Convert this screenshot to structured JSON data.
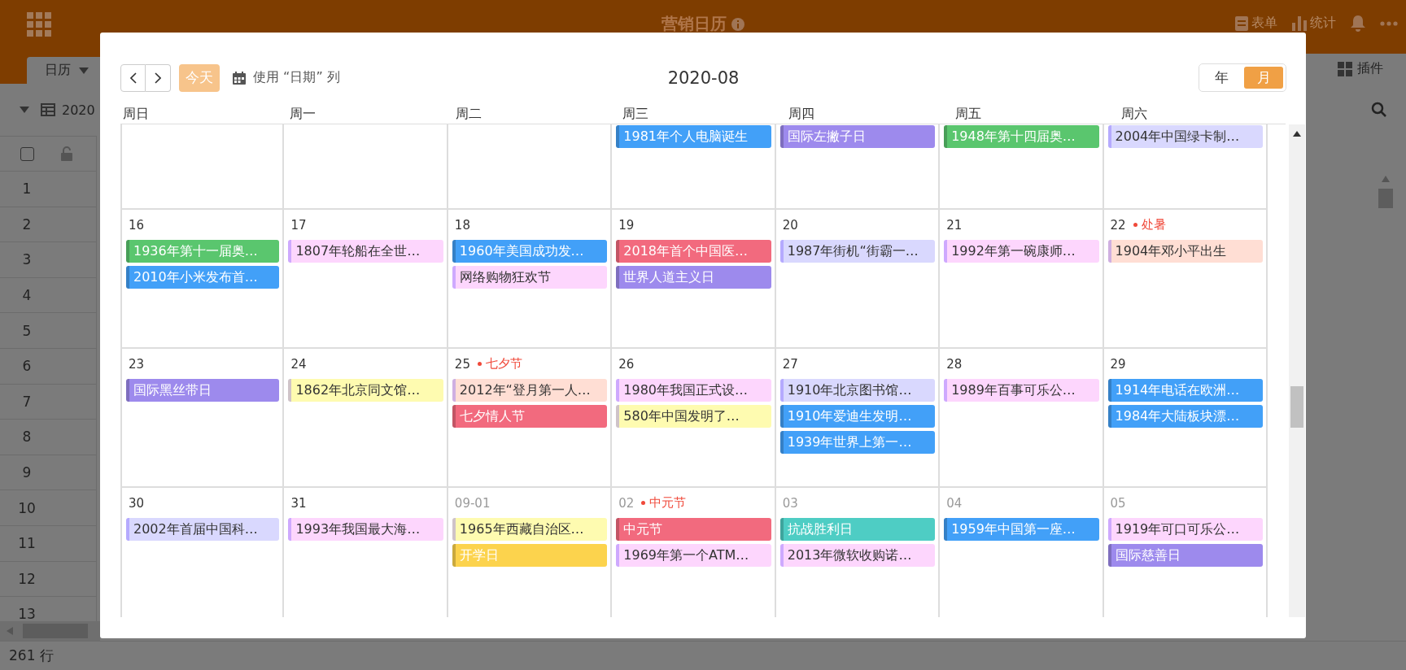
{
  "app": {
    "title": "营销日历",
    "top_actions": [
      {
        "kind": "form",
        "label": "表单"
      },
      {
        "kind": "chart",
        "label": "统计"
      }
    ],
    "tab": {
      "label": "日历"
    },
    "view_name": "2020",
    "select_all": {
      "checked": false
    },
    "plugins": "插件",
    "row_numbers": [
      "1",
      "2",
      "3",
      "4",
      "5",
      "6",
      "7",
      "8",
      "9",
      "10",
      "11",
      "12",
      "13"
    ],
    "status": "261 行"
  },
  "calendar": {
    "today": "今天",
    "date_column": "使用 “日期” 列",
    "title": "2020-08",
    "views": [
      {
        "label": "年",
        "selected": false
      },
      {
        "label": "月",
        "selected": true
      }
    ],
    "weekdays": [
      "周日",
      "周一",
      "周二",
      "周三",
      "周四",
      "周五",
      "周六"
    ],
    "weeks": [
      {
        "days": [
          {
            "events": [
              {
                "text": "1981年个人电脑诞生",
                "kind": "solid",
                "color": "#42a0f8"
              }
            ]
          },
          {
            "events": [
              {
                "text": "国际左撇子日",
                "kind": "solid",
                "color": "#9d8aed"
              }
            ]
          },
          {
            "events": [
              {
                "text": "1948年第十四届奥…",
                "kind": "solid",
                "color": "#5ac66e"
              }
            ]
          },
          {
            "events": [
              {
                "text": "2004年中国绿卡制…",
                "kind": "light",
                "color": "#d9d8fe"
              }
            ]
          }
        ]
      },
      {
        "days": [
          {
            "label": "16",
            "in_month": true,
            "events": [
              {
                "text": "1936年第十一届奥…",
                "kind": "solid",
                "color": "#5ac66e"
              },
              {
                "text": "2010年小米发布首…",
                "kind": "solid",
                "color": "#42a0f8"
              }
            ]
          },
          {
            "label": "17",
            "in_month": true,
            "events": [
              {
                "text": "1807年轮船在全世…",
                "kind": "light",
                "color": "#fdd6fd"
              }
            ]
          },
          {
            "label": "18",
            "in_month": true,
            "events": [
              {
                "text": "1960年美国成功发…",
                "kind": "solid",
                "color": "#42a0f8"
              },
              {
                "text": "网络购物狂欢节",
                "kind": "light",
                "color": "#fdd6fd"
              }
            ]
          },
          {
            "label": "19",
            "in_month": true,
            "events": [
              {
                "text": "2018年首个中国医…",
                "kind": "solid",
                "color": "#f26a7e"
              },
              {
                "text": "世界人道主义日",
                "kind": "solid",
                "color": "#9d8aed"
              }
            ]
          },
          {
            "label": "20",
            "in_month": true,
            "events": [
              {
                "text": "1987年街机“街霸一…",
                "kind": "light",
                "color": "#d9d8fe"
              }
            ]
          },
          {
            "label": "21",
            "in_month": true,
            "events": [
              {
                "text": "1992年第一碗康师…",
                "kind": "light",
                "color": "#fdd6fd"
              }
            ]
          },
          {
            "label": "22",
            "in_month": true,
            "holiday": "处暑",
            "events": [
              {
                "text": "1904年邓小平出生",
                "kind": "light",
                "color": "#ffded4"
              }
            ]
          }
        ]
      },
      {
        "days": [
          {
            "label": "23",
            "in_month": true,
            "events": [
              {
                "text": "国际黑丝带日",
                "kind": "solid",
                "color": "#9d8aed"
              }
            ]
          },
          {
            "label": "24",
            "in_month": true,
            "events": [
              {
                "text": "1862年北京同文馆…",
                "kind": "light",
                "color": "#fefbb0"
              }
            ]
          },
          {
            "label": "25",
            "in_month": true,
            "holiday": "七夕节",
            "events": [
              {
                "text": "2012年“登月第一人…",
                "kind": "light",
                "color": "#ffded4"
              },
              {
                "text": "七夕情人节",
                "kind": "solid",
                "color": "#f26a7e"
              }
            ]
          },
          {
            "label": "26",
            "in_month": true,
            "events": [
              {
                "text": "1980年我国正式设…",
                "kind": "light",
                "color": "#fdd6fd"
              },
              {
                "text": "580年中国发明了…",
                "kind": "light",
                "color": "#fefbb0"
              }
            ]
          },
          {
            "label": "27",
            "in_month": true,
            "events": [
              {
                "text": "1910年北京图书馆…",
                "kind": "light",
                "color": "#d9d8fe"
              },
              {
                "text": "1910年爱迪生发明…",
                "kind": "solid",
                "color": "#42a0f8"
              },
              {
                "text": "1939年世界上第一…",
                "kind": "solid",
                "color": "#42a0f8"
              }
            ]
          },
          {
            "label": "28",
            "in_month": true,
            "events": [
              {
                "text": "1989年百事可乐公…",
                "kind": "light",
                "color": "#fdd6fd"
              }
            ]
          },
          {
            "label": "29",
            "in_month": true,
            "events": [
              {
                "text": "1914年电话在欧洲…",
                "kind": "solid",
                "color": "#42a0f8"
              },
              {
                "text": "1984年大陆板块漂…",
                "kind": "solid",
                "color": "#42a0f8"
              }
            ]
          }
        ]
      },
      {
        "days": [
          {
            "label": "30",
            "in_month": true,
            "events": [
              {
                "text": "2002年首届中国科…",
                "kind": "light",
                "color": "#d9d8fe"
              }
            ]
          },
          {
            "label": "31",
            "in_month": true,
            "events": [
              {
                "text": "1993年我国最大海…",
                "kind": "light",
                "color": "#fdd6fd"
              }
            ]
          },
          {
            "label": "09-01",
            "in_month": false,
            "events": [
              {
                "text": "1965年西藏自治区…",
                "kind": "light",
                "color": "#fefbb0"
              },
              {
                "text": "开学日",
                "kind": "solid",
                "color": "#fcd34d"
              }
            ]
          },
          {
            "label": "02",
            "in_month": false,
            "holiday": "中元节",
            "events": [
              {
                "text": "中元节",
                "kind": "solid",
                "color": "#f26a7e"
              },
              {
                "text": "1969年第一个ATM…",
                "kind": "light",
                "color": "#fdd6fd"
              }
            ]
          },
          {
            "label": "03",
            "in_month": false,
            "events": [
              {
                "text": "抗战胜利日",
                "kind": "solid",
                "color": "#4ecdc4"
              },
              {
                "text": "2013年微软收购诺…",
                "kind": "light",
                "color": "#fdd6fd"
              }
            ]
          },
          {
            "label": "04",
            "in_month": false,
            "events": [
              {
                "text": "1959年中国第一座…",
                "kind": "solid",
                "color": "#42a0f8"
              }
            ]
          },
          {
            "label": "05",
            "in_month": false,
            "events": [
              {
                "text": "1919年可口可乐公…",
                "kind": "light",
                "color": "#fdd6fd"
              },
              {
                "text": "国际慈善日",
                "kind": "solid",
                "color": "#9d8aed"
              }
            ]
          }
        ]
      }
    ]
  }
}
